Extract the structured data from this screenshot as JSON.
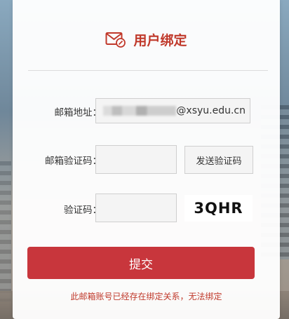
{
  "dialog": {
    "title": "用户绑定",
    "icon": "mail-edit-icon"
  },
  "form": {
    "email_label": "邮箱地址：",
    "email_value_suffix": "@xsyu.edu.cn",
    "email_code_label": "邮箱验证码：",
    "email_code_value": "",
    "send_code_button": "发送验证码",
    "captcha_label": "验证码：",
    "captcha_value": "",
    "captcha_image_text": "3QHR"
  },
  "actions": {
    "submit_label": "提交"
  },
  "messages": {
    "error": "此邮箱账号已经存在绑定关系，无法绑定"
  },
  "colors": {
    "accent": "#c8363c",
    "error_text": "#c0392b"
  }
}
